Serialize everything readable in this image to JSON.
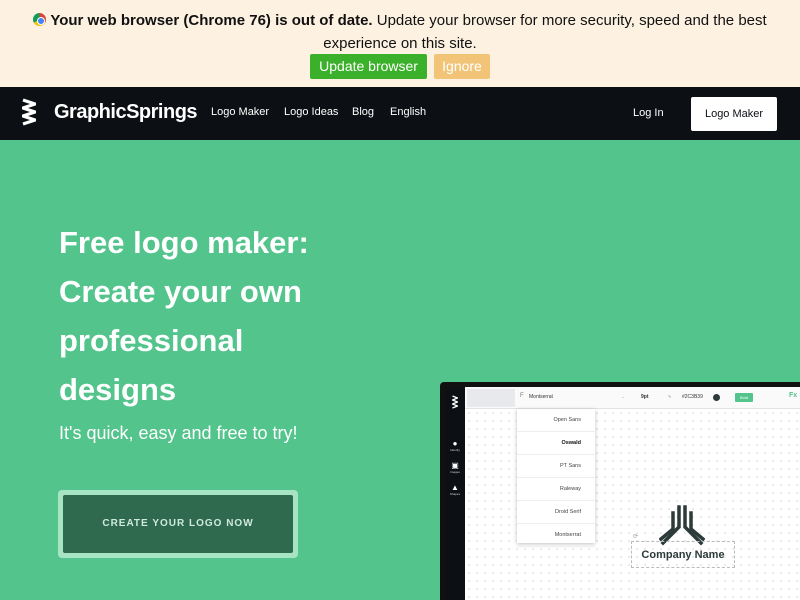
{
  "banner": {
    "bold_text": "Your web browser (Chrome 76) is out of date.",
    "text": "Update your browser for more security, speed and the best experience on this site.",
    "update_label": "Update browser",
    "ignore_label": "Ignore"
  },
  "nav": {
    "brand": "GraphicSprings",
    "links": [
      "Logo Maker",
      "Logo Ideas",
      "Blog",
      "English"
    ],
    "login": "Log In",
    "cta": "Logo Maker"
  },
  "hero": {
    "title_lines": [
      "Free logo maker:",
      "Create your own",
      "professional",
      "designs"
    ],
    "subtitle": "It's quick, easy and free to try!",
    "cta": "CREATE YOUR LOGO NOW"
  },
  "mock": {
    "sidebar": [
      "Identity",
      "Images",
      "Shapes"
    ],
    "toolbar": {
      "font": "Montserrat",
      "font_prefix": "F",
      "size": "9pt",
      "color": "#2C3B39",
      "bold": "Bold",
      "fx": "Fx"
    },
    "fonts": [
      "Open Sans",
      "Oswald",
      "PT Sans",
      "Raleway",
      "Droid Serif",
      "Montserrat"
    ],
    "company_name": "Company Name"
  },
  "colors": {
    "hero_bg": "#52c48c",
    "nav_bg": "#0c0f14",
    "banner_bg": "#fdf2e2",
    "update_btn": "#3bb02a",
    "ignore_btn": "#f1c477",
    "cta_bg": "#2f6a4e"
  }
}
